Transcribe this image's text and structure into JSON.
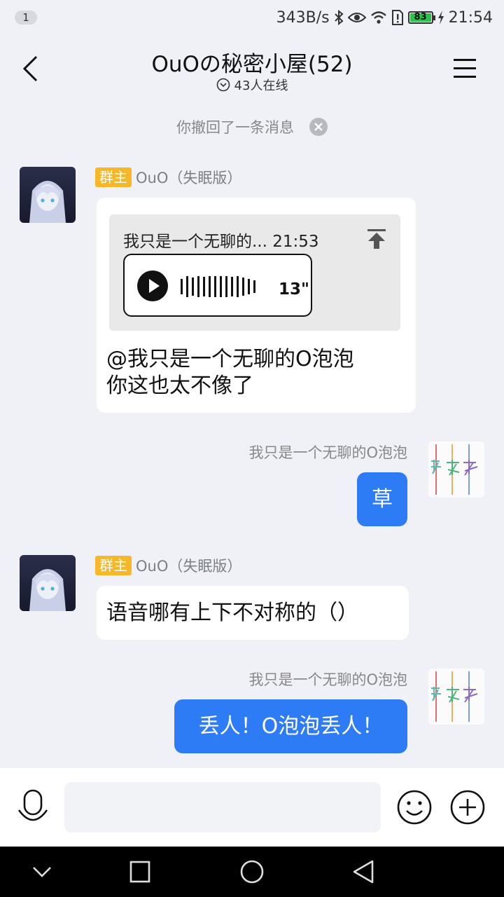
{
  "status_bar": {
    "notification_count": "1",
    "net_speed": "343B/s",
    "battery_level": "83",
    "time": "21:54"
  },
  "header": {
    "title": "OuOの秘密小屋(52)",
    "online": "43人在线"
  },
  "recall_notice": "你撤回了一条消息",
  "messages": [
    {
      "direction": "incoming",
      "tag": "群主",
      "sender": "OuO（失眠版）",
      "quote": {
        "header": "我只是一个无聊的... 21:53",
        "voice_duration": "13\""
      },
      "text_line1": "@我只是一个无聊的O泡泡",
      "text_line2": "你这也太不像了"
    },
    {
      "direction": "outgoing",
      "sender": "我只是一个无聊的O泡泡",
      "text": "草"
    },
    {
      "direction": "incoming",
      "tag": "群主",
      "sender": "OuO（失眠版）",
      "text": "语音哪有上下不对称的（）"
    },
    {
      "direction": "outgoing",
      "sender": "我只是一个无聊的O泡泡",
      "text": "丢人！O泡泡丢人！"
    }
  ],
  "input": {
    "placeholder": ""
  },
  "colors": {
    "background": "#eff1f6",
    "outgoing_bubble": "#2d7cf6",
    "owner_tag": "#f6b729"
  }
}
